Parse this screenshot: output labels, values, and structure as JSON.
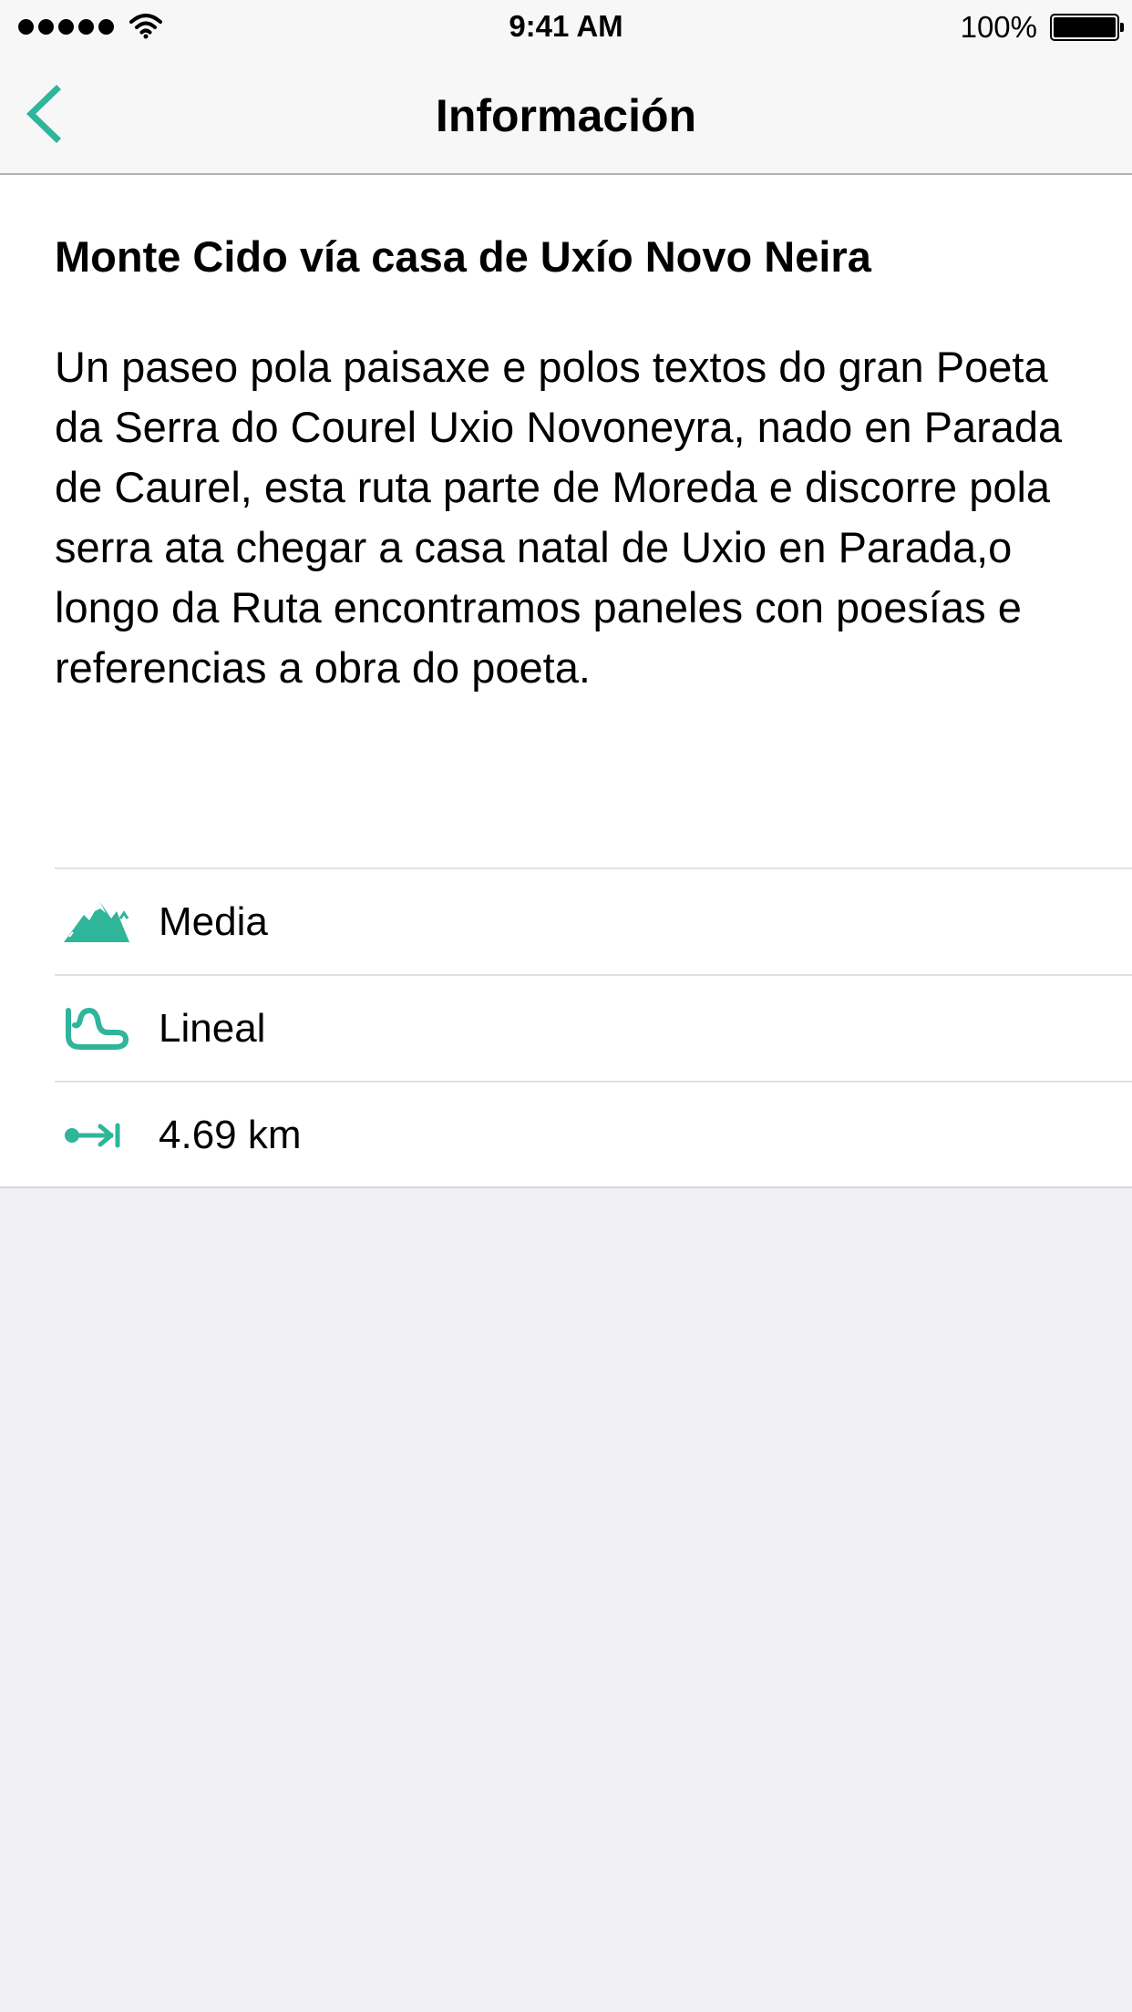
{
  "status_bar": {
    "time": "9:41 AM",
    "battery_percent": "100%",
    "battery_level": 1.0
  },
  "nav": {
    "title": "Información",
    "back_icon": "chevron-left-icon"
  },
  "route": {
    "title": "Monte Cido vía casa de Uxío Novo Neira",
    "description": "Un paseo pola paisaxe e polos textos do gran Poeta da Serra do Courel Uxio Novoneyra, nado en Parada de Caurel, esta ruta parte de Moreda e discorre pola serra ata chegar a casa natal de Uxio en Parada,o longo da Ruta encontramos paneles con poesías e referencias a obra do poeta."
  },
  "info": [
    {
      "icon": "mountain-icon",
      "label": "Media"
    },
    {
      "icon": "winding-route-icon",
      "label": "Lineal"
    },
    {
      "icon": "distance-arrow-icon",
      "label": "4.69 km"
    }
  ],
  "colors": {
    "accent": "#2fb59a",
    "bar_background": "#f7f7f7",
    "page_background": "#efeff4"
  }
}
